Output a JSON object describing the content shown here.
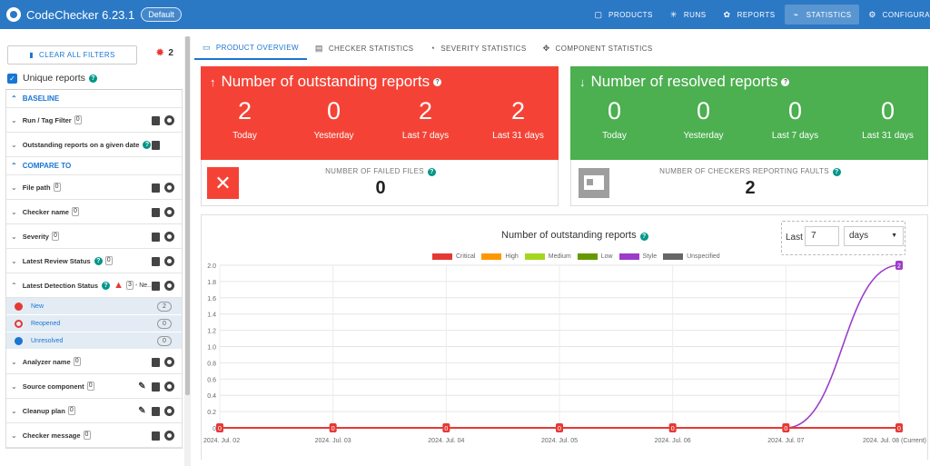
{
  "header": {
    "app_title": "CodeChecker 6.23.1",
    "product_badge": "Default",
    "nav": [
      {
        "label": "PRODUCTS",
        "icon": "products-icon",
        "active": false
      },
      {
        "label": "RUNS",
        "icon": "runs-icon",
        "active": false
      },
      {
        "label": "REPORTS",
        "icon": "reports-icon",
        "active": false
      },
      {
        "label": "STATISTICS",
        "icon": "statistics-icon",
        "active": true
      },
      {
        "label": "CONFIGURATION",
        "icon": "gear-icon",
        "active": false
      }
    ]
  },
  "sidebar": {
    "clear_label": "CLEAR ALL FILTERS",
    "bug_count": "2",
    "unique_label": "Unique reports",
    "baseline_label": "BASELINE",
    "compare_label": "COMPARE TO",
    "baseline_filters": [
      {
        "label": "Run / Tag Filter",
        "count": "0"
      },
      {
        "label": "Outstanding reports on a given date",
        "count": ""
      }
    ],
    "filters": [
      {
        "label": "File path",
        "count": "0"
      },
      {
        "label": "Checker name",
        "count": "0"
      },
      {
        "label": "Severity",
        "count": "0"
      },
      {
        "label": "Latest Review Status",
        "count": "0"
      }
    ],
    "detection": {
      "label": "Latest Detection Status",
      "count": "3",
      "extra": "- Ne...",
      "items": [
        {
          "label": "New",
          "count": "2",
          "color": "#e53935"
        },
        {
          "label": "Reopened",
          "count": "0",
          "color": "#e53935"
        },
        {
          "label": "Unresolved",
          "count": "0",
          "color": "#1976d2"
        }
      ]
    },
    "filters_after": [
      {
        "label": "Analyzer name",
        "count": "0"
      },
      {
        "label": "Source component",
        "count": "0"
      },
      {
        "label": "Cleanup plan",
        "count": "0"
      },
      {
        "label": "Checker message",
        "count": "0"
      }
    ]
  },
  "tabs": [
    {
      "label": "PRODUCT OVERVIEW",
      "active": true
    },
    {
      "label": "CHECKER STATISTICS",
      "active": false
    },
    {
      "label": "SEVERITY STATISTICS",
      "active": false
    },
    {
      "label": "COMPONENT STATISTICS",
      "active": false
    }
  ],
  "outstanding": {
    "title": "Number of outstanding reports",
    "stats": [
      {
        "value": "2",
        "label": "Today"
      },
      {
        "value": "0",
        "label": "Yesterday"
      },
      {
        "value": "2",
        "label": "Last 7 days"
      },
      {
        "value": "2",
        "label": "Last 31 days"
      }
    ]
  },
  "resolved": {
    "title": "Number of resolved reports",
    "stats": [
      {
        "value": "0",
        "label": "Today"
      },
      {
        "value": "0",
        "label": "Yesterday"
      },
      {
        "value": "0",
        "label": "Last 7 days"
      },
      {
        "value": "0",
        "label": "Last 31 days"
      }
    ]
  },
  "failed_files": {
    "label": "NUMBER OF FAILED FILES",
    "value": "0"
  },
  "checkers_faults": {
    "label": "NUMBER OF CHECKERS REPORTING FAULTS",
    "value": "2"
  },
  "range": {
    "label": "Last",
    "value": "7",
    "unit": "days"
  },
  "chart_data": {
    "type": "line",
    "title": "Number of outstanding reports",
    "x": [
      "2024. Jul. 02",
      "2024. Jul. 03",
      "2024. Jul. 04",
      "2024. Jul. 05",
      "2024. Jul. 06",
      "2024. Jul. 07",
      "2024. Jul. 08 (Current)"
    ],
    "ylim": [
      0,
      2.0
    ],
    "yticks": [
      "0",
      "0.2",
      "0.4",
      "0.6",
      "0.8",
      "1.0",
      "1.2",
      "1.4",
      "1.6",
      "1.8",
      "2.0"
    ],
    "series": [
      {
        "name": "Critical",
        "color": "#e53935",
        "values": [
          0,
          0,
          0,
          0,
          0,
          0,
          0
        ]
      },
      {
        "name": "High",
        "color": "#ff9800",
        "values": [
          0,
          0,
          0,
          0,
          0,
          0,
          0
        ]
      },
      {
        "name": "Medium",
        "color": "#a5d61f",
        "values": [
          0,
          0,
          0,
          0,
          0,
          0,
          0
        ]
      },
      {
        "name": "Low",
        "color": "#669900",
        "values": [
          0,
          0,
          0,
          0,
          0,
          0,
          0
        ]
      },
      {
        "name": "Style",
        "color": "#9c3cc9",
        "values": [
          0,
          0,
          0,
          0,
          0,
          0,
          2
        ]
      },
      {
        "name": "Unspecified",
        "color": "#666666",
        "values": [
          0,
          0,
          0,
          0,
          0,
          0,
          0
        ]
      }
    ],
    "point_labels": {
      "Critical": [
        "0",
        "0",
        "0",
        "0",
        "0",
        "0",
        "0"
      ],
      "Style": [
        "",
        "",
        "",
        "",
        "",
        "",
        "2"
      ]
    }
  }
}
